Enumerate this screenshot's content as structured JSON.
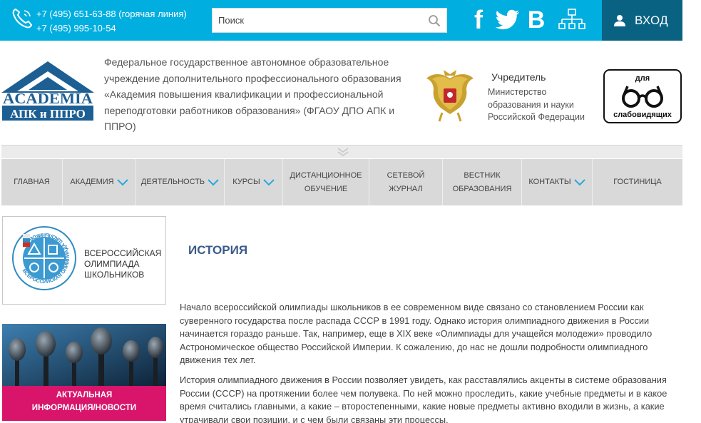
{
  "topbar": {
    "phone1": "+7 (495) 651-63-88 (горячая линия)",
    "phone2": "+7 (495) 995-10-54",
    "search_placeholder": "Поиск",
    "login_label": "ВХОД",
    "social_icons": [
      "facebook-icon",
      "twitter-icon",
      "vk-icon",
      "sitemap-icon"
    ]
  },
  "header": {
    "logo_line1": "ACADEMIA",
    "logo_line2": "АПК и ППРО",
    "org_name": "Федеральное государственное автономное образовательное учреждение дополнительного профессионального образования «Академия повышения квалификации и профессиональной переподготовки работников образования» (ФГАОУ ДПО АПК и ППРО)",
    "founder_title": "Учредитель",
    "founder_name": "Министерство образования и науки Российской Федерации",
    "vision_top": "для",
    "vision_bottom": "слабовидящих"
  },
  "nav": {
    "items": [
      {
        "label": "Главная",
        "dropdown": false
      },
      {
        "label": "Академия",
        "dropdown": true
      },
      {
        "label": "Деятельность",
        "dropdown": true
      },
      {
        "label": "Курсы",
        "dropdown": true
      },
      {
        "label": "Дистанционное обучение",
        "dropdown": false
      },
      {
        "label": "Сетевой журнал",
        "dropdown": false
      },
      {
        "label": "Вестник образования",
        "dropdown": false
      },
      {
        "label": "Контакты",
        "dropdown": true
      },
      {
        "label": "Гостиница",
        "dropdown": false
      }
    ]
  },
  "sidebar": {
    "olympiad_title": "Всероссийская олимпиада школьников",
    "olympiad_logo_ring_text": "ВСЕРОССИЙСКАЯ ОЛИМПИАДА ШКОЛЬНИКОВ",
    "news_label_line1": "АКТУАЛЬНАЯ",
    "news_label_line2": "ИНФОРМАЦИЯ/НОВОСТИ"
  },
  "main": {
    "title": "ИСТОРИЯ",
    "paragraphs": [
      "Начало всероссийской олимпиады школьников в ее современном виде связано со становлением России как суверенного государства после распада СССР в 1991 году. Однако история олимпиадного движения в России начинается гораздо раньше. Так, например, еще в XIX веке «Олимпиады для учащейся молодежи» проводило Астрономическое общество Российской Империи. К сожалению, до нас не дошли подробности олимпиадного движения тех лет.",
      "История олимпиадного движения в России позволяет увидеть, как расставлялись акценты в системе образования России (СССР) на протяжении более чем полувека. По ней можно проследить, какие учебные предметы и в какое время считались главными, а какие – второстепенными, какие новые предметы активно входили в жизнь, а какие утрачивали свои позиции, и с чем были связаны эти процессы."
    ]
  },
  "colors": {
    "topbar": "#00aee0",
    "login_bg": "#0a6283",
    "nav_bg": "#d9d9d9",
    "chevron": "#27a9dd",
    "title": "#3a5a89",
    "news_label": "#d8156b",
    "logo_blue": "#1d5f93"
  }
}
